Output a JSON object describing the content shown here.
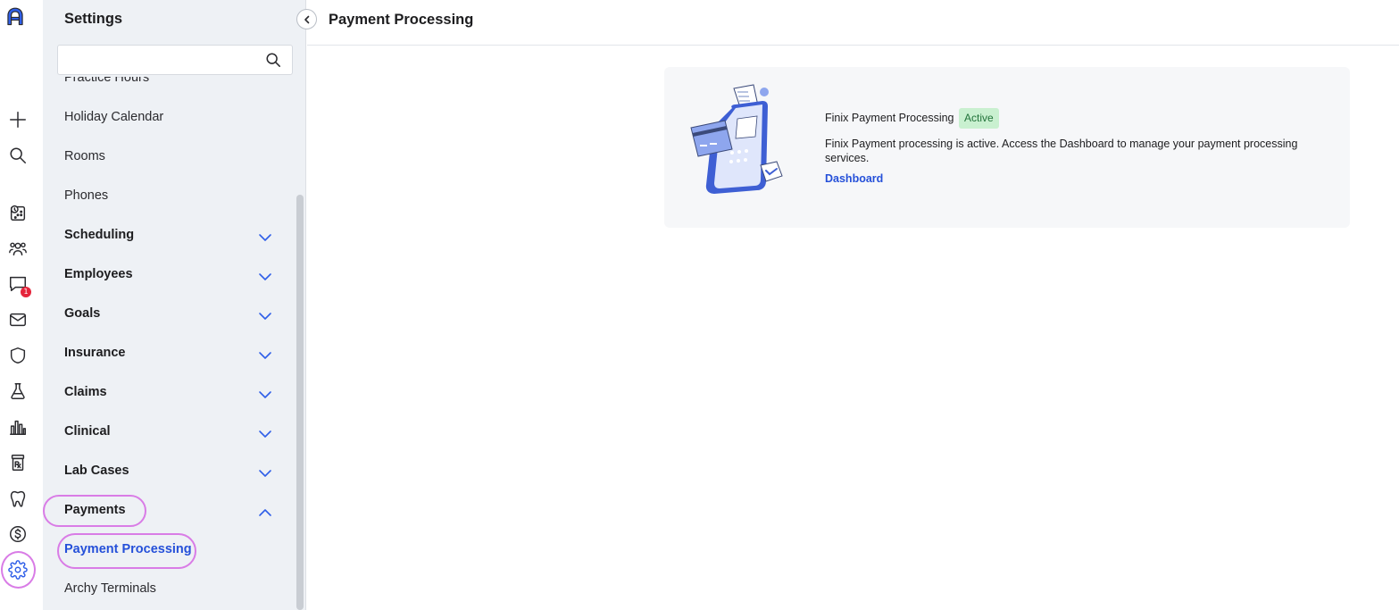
{
  "sidebar": {
    "title": "Settings",
    "search": {
      "value": "",
      "placeholder": ""
    },
    "items": [
      {
        "label": "Practice Hours"
      },
      {
        "label": "Holiday Calendar"
      },
      {
        "label": "Rooms"
      },
      {
        "label": "Phones"
      },
      {
        "label": "Scheduling",
        "expanded": false
      },
      {
        "label": "Employees",
        "expanded": false
      },
      {
        "label": "Goals",
        "expanded": false
      },
      {
        "label": "Insurance",
        "expanded": false
      },
      {
        "label": "Claims",
        "expanded": false
      },
      {
        "label": "Clinical",
        "expanded": false
      },
      {
        "label": "Lab Cases",
        "expanded": false
      },
      {
        "label": "Payments",
        "expanded": true
      },
      {
        "label": "Payment Processing",
        "selected": true
      },
      {
        "label": "Archy Terminals"
      }
    ]
  },
  "rail": {
    "icons": [
      "archy-logo",
      "plus-icon",
      "search-icon",
      "schedule-icon",
      "patients-icon",
      "messages-icon",
      "mail-icon",
      "shield-icon",
      "lab-flask-icon",
      "reports-chart-icon",
      "prescription-icon",
      "tooth-icon",
      "billing-dollar-icon",
      "settings-gear-icon"
    ],
    "messages_badge": "1"
  },
  "header": {
    "title": "Payment Processing"
  },
  "card": {
    "name": "Finix Payment Processing",
    "status": "Active",
    "description": "Finix Payment processing is active. Access the Dashboard to manage your payment processing services.",
    "link": "Dashboard"
  },
  "colors": {
    "accent": "#2f5fe8",
    "link": "#2550d9",
    "highlight_ring": "#d97ce6",
    "active_badge_bg": "#c9f0d0",
    "active_badge_text": "#22733a",
    "notification": "#e5243b"
  }
}
